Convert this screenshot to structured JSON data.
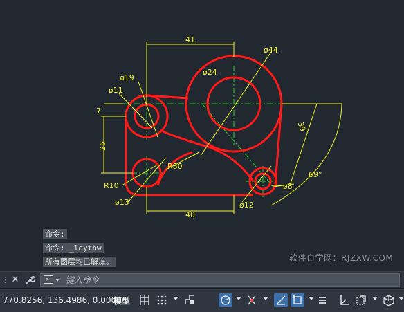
{
  "drawing": {
    "dims": {
      "d41": "41",
      "d44": "ø44",
      "d19": "ø19",
      "d24": "ø24",
      "d11": "ø11",
      "d7": "7",
      "d39": "39",
      "d26": "26",
      "r80": "R80",
      "a69": "69°",
      "r10": "R10",
      "d8": "ø8",
      "d13": "ø13",
      "d12": "ø12",
      "d40": "40"
    },
    "colors": {
      "object": "#ff1a1a",
      "dimension": "#f2f22a",
      "center": "#24d024",
      "background": "#212830"
    }
  },
  "command_history": [
    "命令:",
    "命令: _laythw",
    "所有图层均已解冻。"
  ],
  "watermark": "软件自学网：RJZXW.COM",
  "command_bar": {
    "close_icon": "close-icon",
    "customize_icon": "wrench-icon",
    "prompt_icon": "command-prompt-icon",
    "input_placeholder": "键入命令"
  },
  "status_bar": {
    "coordinates": "770.8256, 136.4986, 0.0000",
    "model_label": "模型"
  }
}
